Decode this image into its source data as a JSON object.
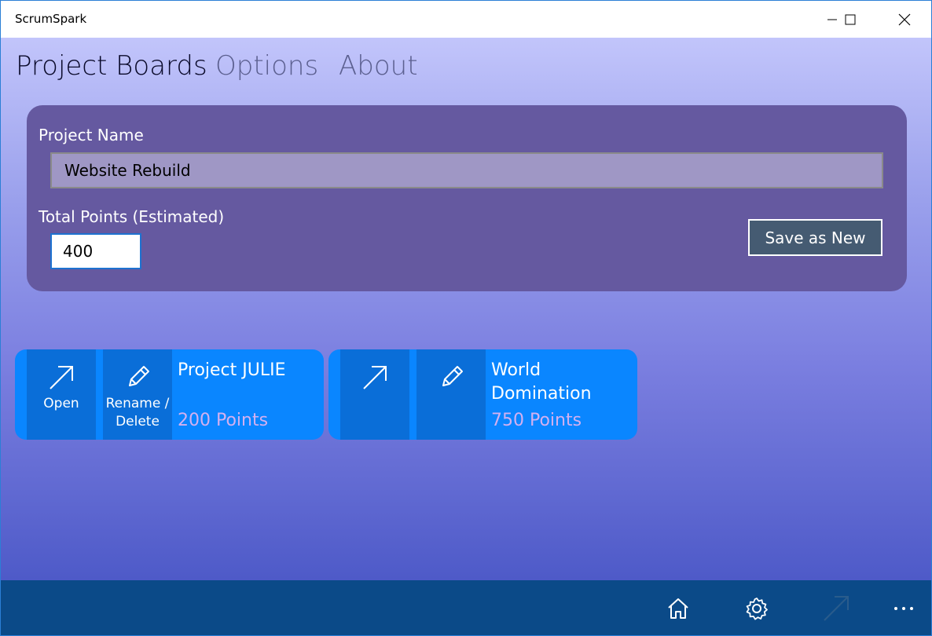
{
  "app": {
    "title": "ScrumSpark"
  },
  "nav": {
    "tabs": [
      {
        "label": "Project Boards",
        "active": true
      },
      {
        "label": "Options",
        "active": false
      },
      {
        "label": "About",
        "active": false
      }
    ]
  },
  "form": {
    "project_name_label": "Project Name",
    "project_name_value": "Website Rebuild",
    "total_points_label": "Total Points (Estimated)",
    "total_points_value": "400",
    "save_button_label": "Save as New"
  },
  "projects": [
    {
      "title": "Project JULIE",
      "points": "200 Points",
      "open_label": "Open",
      "rename_label_line1": "Rename /",
      "rename_label_line2": "Delete"
    },
    {
      "title": "World Domination",
      "points": "750 Points",
      "open_label": "",
      "rename_label_line1": "",
      "rename_label_line2": ""
    }
  ],
  "bottom_bar": {
    "icons": [
      "home-icon",
      "settings-icon",
      "open-arrow-icon",
      "more-icon"
    ]
  },
  "colors": {
    "panel": "#6559a0",
    "card": "#0a86ff",
    "card_button": "#0a6ed8",
    "points_text": "#d3b0f0",
    "bottom_bar": "#0b4a88"
  }
}
